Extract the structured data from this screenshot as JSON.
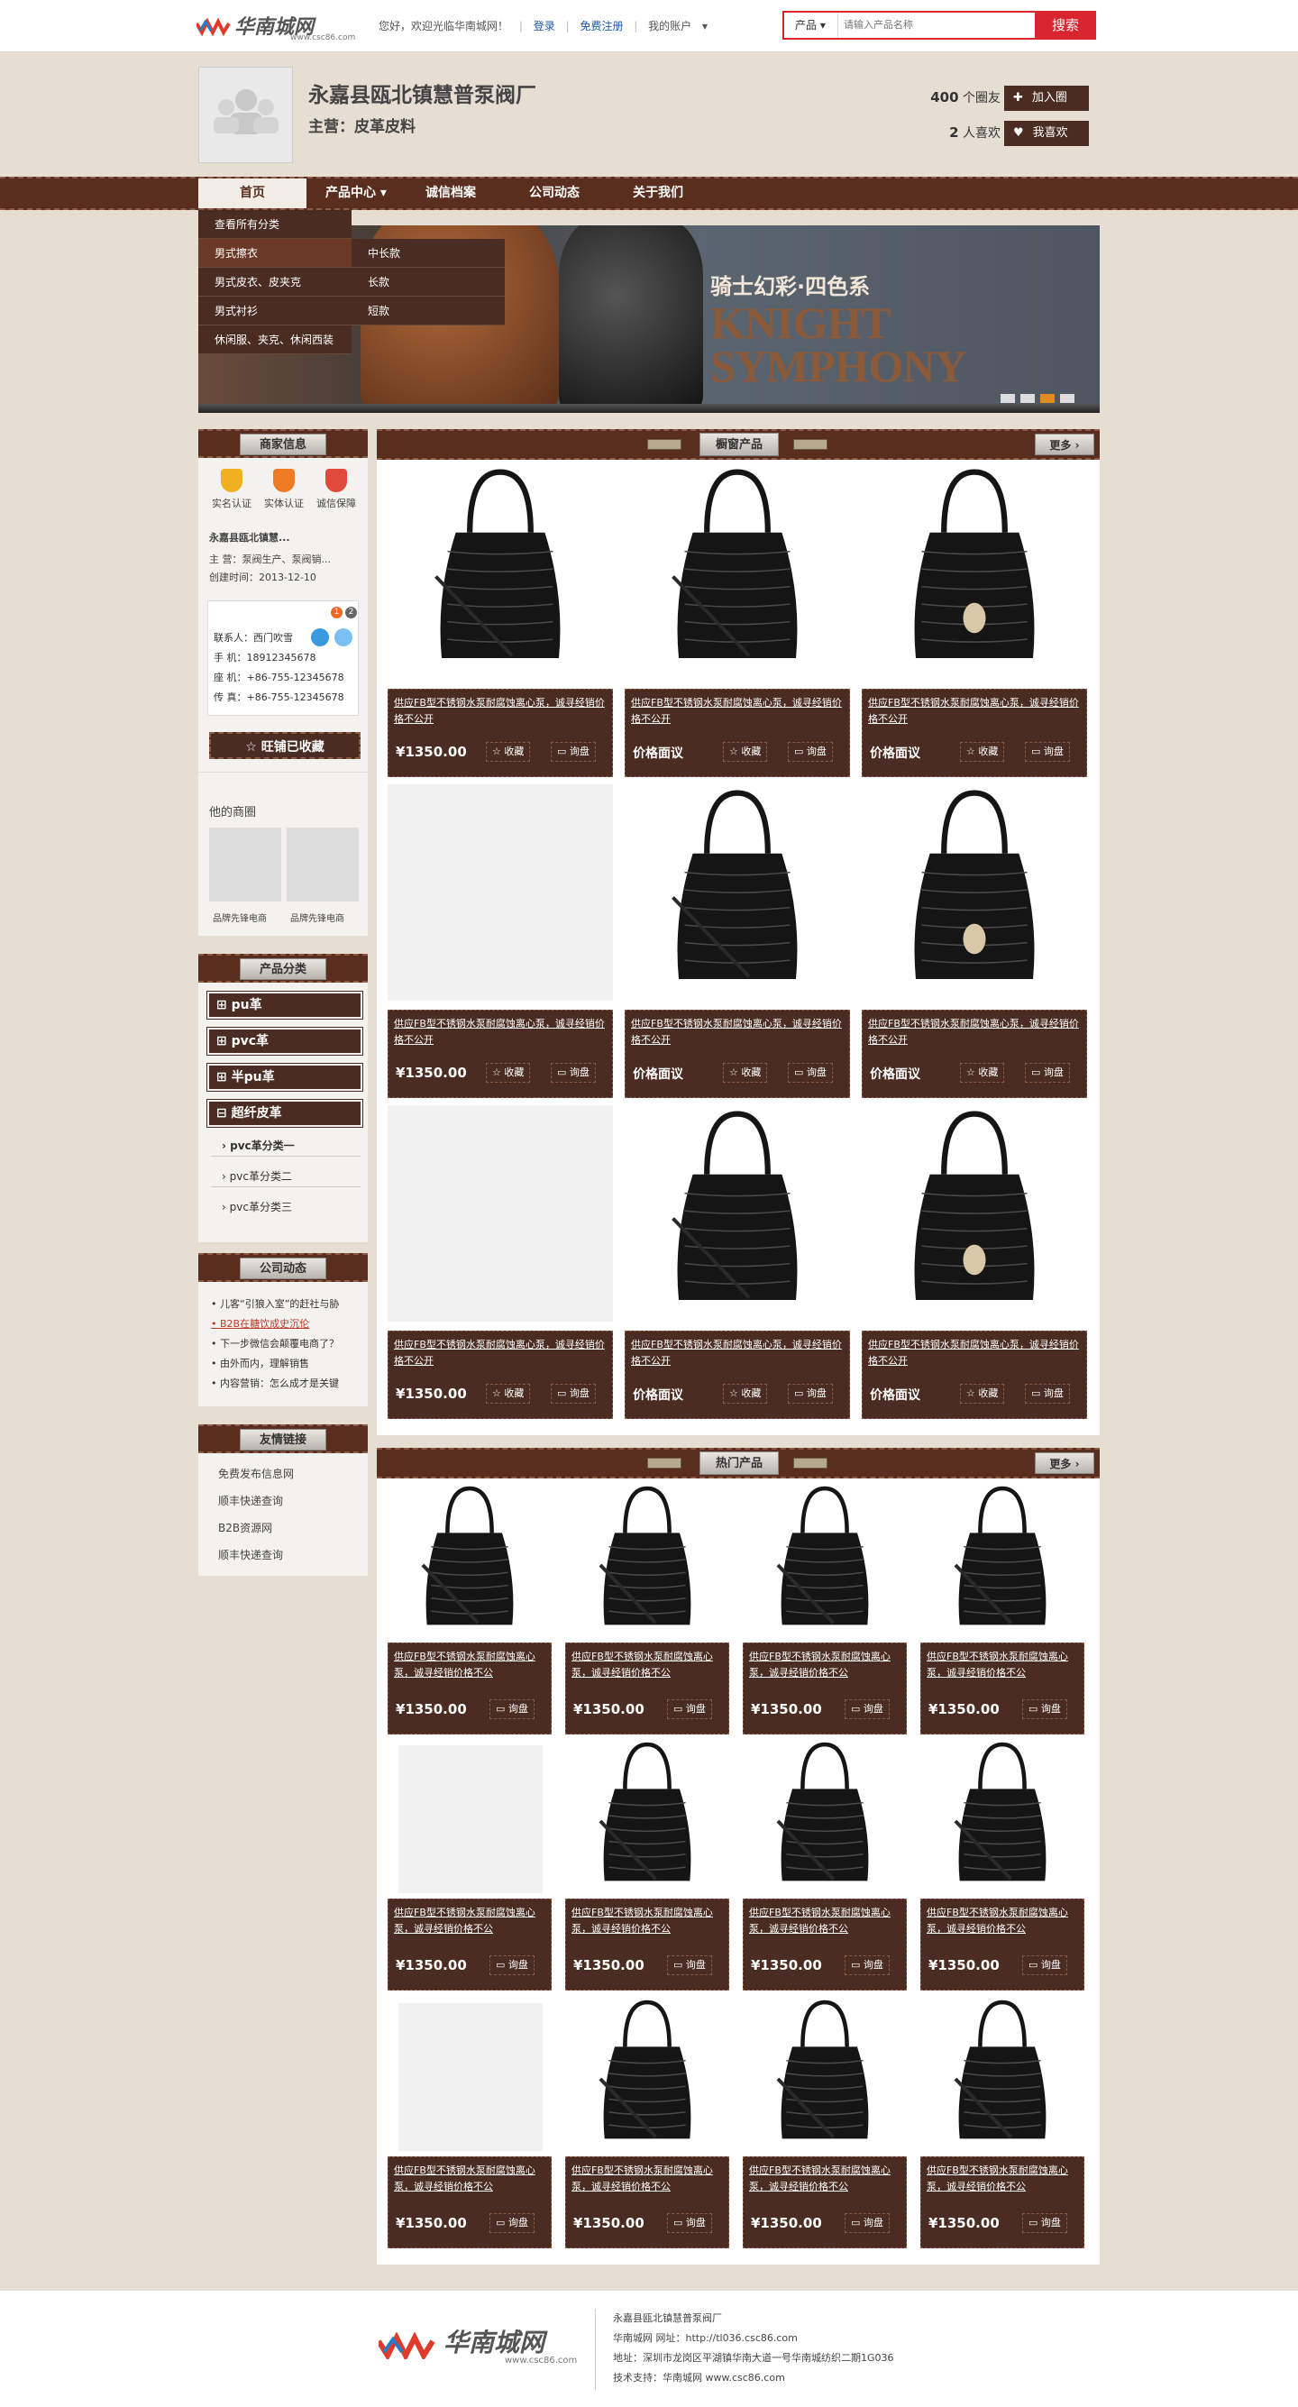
{
  "topbar": {
    "logo_text": "华南城网",
    "logo_url": "www.csc86.com",
    "welcome": "您好，欢迎光临华南城网！",
    "login": "登录",
    "register": "免费注册",
    "my_account": "我的账户",
    "search_category": "产品",
    "search_placeholder": "请输入产品名称",
    "search_button": "搜索"
  },
  "header": {
    "shop_name": "永嘉县瓯北镇慧普泵阀厂",
    "main_business": "主营：皮革皮料",
    "followers_count": "400",
    "followers_label": "个圈友",
    "join_button": "加入圈",
    "likes_count": "2",
    "likes_label": "人喜欢",
    "like_button": "我喜欢"
  },
  "nav": {
    "items": [
      "首页",
      "产品中心",
      "诚信档案",
      "公司动态",
      "关于我们"
    ],
    "dropdown": [
      "查看所有分类",
      "男式擦衣",
      "男式皮衣、皮夹克",
      "男式衬衫",
      "休闲服、夹克、休闲西装"
    ],
    "subdropdown": [
      "中长款",
      "长款",
      "短款"
    ]
  },
  "banner": {
    "title_cn": "骑士幻彩·四色系",
    "title_en_1": "KNIGHT",
    "title_en_2": "SYMPHONY"
  },
  "sidebar": {
    "merchant_title": "商家信息",
    "certs": [
      "实名认证",
      "实体认证",
      "诚信保障"
    ],
    "company_short": "永嘉县瓯北镇慧...",
    "main_line": "主    营：泵阀生产、泵阀销...",
    "created": "创建时间：2013-12-10",
    "badge_1": "1",
    "badge_2": "2",
    "contact_person": "联系人：西门吹雪",
    "mobile": "手    机：18912345678",
    "phone": "座    机：+86-755-12345678",
    "fax": "传    真：+86-755-12345678",
    "fav_button": "旺铺已收藏",
    "other_shops_title": "他的商圈",
    "other_shops": [
      "品牌先锋电商",
      "品牌先锋电商"
    ],
    "category_title": "产品分类",
    "categories": [
      "pu革",
      "pvc革",
      "半pu革",
      "超纤皮革"
    ],
    "subcategories": [
      "pvc革分类一",
      "pvc革分类二",
      "pvc革分类三"
    ],
    "news_title": "公司动态",
    "news": [
      "儿客“引狼入室”的赶社与胁",
      "B2B在糖饮成史沉伦",
      "下一步微信会颠覆电商了？",
      "由外而内，理解销售",
      "内容营销：怎么成才是关键"
    ],
    "links_title": "友情链接",
    "links": [
      "免费发布信息网",
      "顺丰快递查询",
      "B2B资源网",
      "顺丰快递查询"
    ]
  },
  "showcase": {
    "title": "橱窗产品",
    "more": "更多",
    "desc": "供应FB型不锈钢水泵耐腐蚀离心泵，诚寻经销价格不公开",
    "price": "¥1350.00",
    "price_ask": "价格面议",
    "fav": "收藏",
    "inquiry": "询盘"
  },
  "hot": {
    "title": "热门产品",
    "more": "更多",
    "desc": "供应FB型不锈钢水泵耐腐蚀离心泵，诚寻经销价格不公",
    "price": "¥1350.00",
    "inquiry": "询盘"
  },
  "footer": {
    "company": "永嘉县瓯北镇慧普泵阀厂",
    "site": "华南城网    网址：http://tl036.csc86.com",
    "address": "地址：深圳市龙岗区平湖镇华南大道一号华南城纺织二期1G036",
    "support": "技术支持：华南城网    www.csc86.com"
  },
  "colors": {
    "leather": "#5a2e1e",
    "card": "#4a2c22",
    "accent_red": "#d9252f",
    "dot_active": "#e38b1c"
  }
}
